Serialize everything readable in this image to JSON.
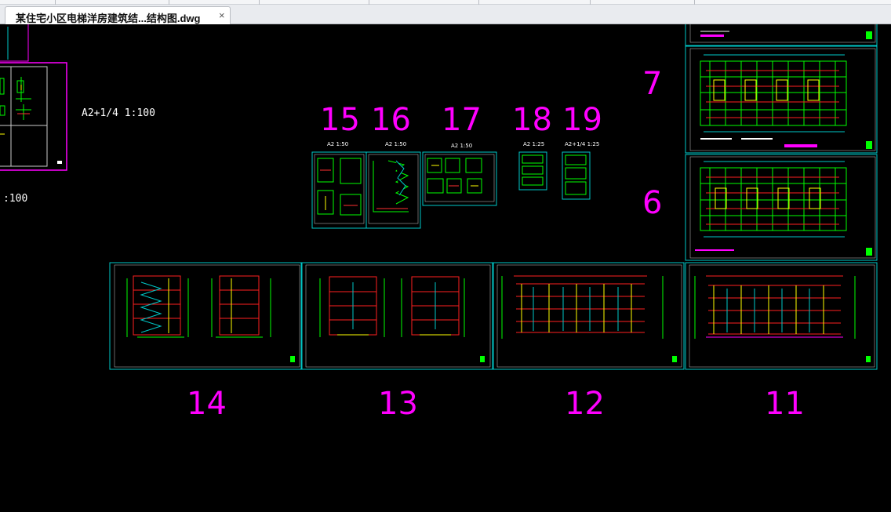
{
  "tab": {
    "title": "某住宅小区电梯洋房建筑结...结构图.dwg",
    "close_glyph": "×"
  },
  "canvas": {
    "scale_note_main": "A2+1/4   1:100",
    "scale_note_left": ":100",
    "colors": {
      "background": "#000000",
      "sheet_border": "#00c8c8",
      "left_sheet_border": "#ff00ff",
      "sheet_numbers": "#ff00ff",
      "drawing_lines": "#00ff00",
      "detail_red": "#ff2020",
      "detail_yellow": "#ffff00"
    },
    "sheet_numbers": {
      "n7": "7",
      "n6": "6",
      "n11": "11",
      "n12": "12",
      "n13": "13",
      "n14": "14",
      "n15": "15",
      "n16": "16",
      "n17": "17",
      "n18": "18",
      "n19": "19"
    },
    "scale_labels": {
      "s15": "A2  1:50",
      "s16": "A2  1:50",
      "s17": "A2  1:50",
      "s18": "A2  1:25",
      "s19": "A2+1/4  1:25"
    }
  }
}
